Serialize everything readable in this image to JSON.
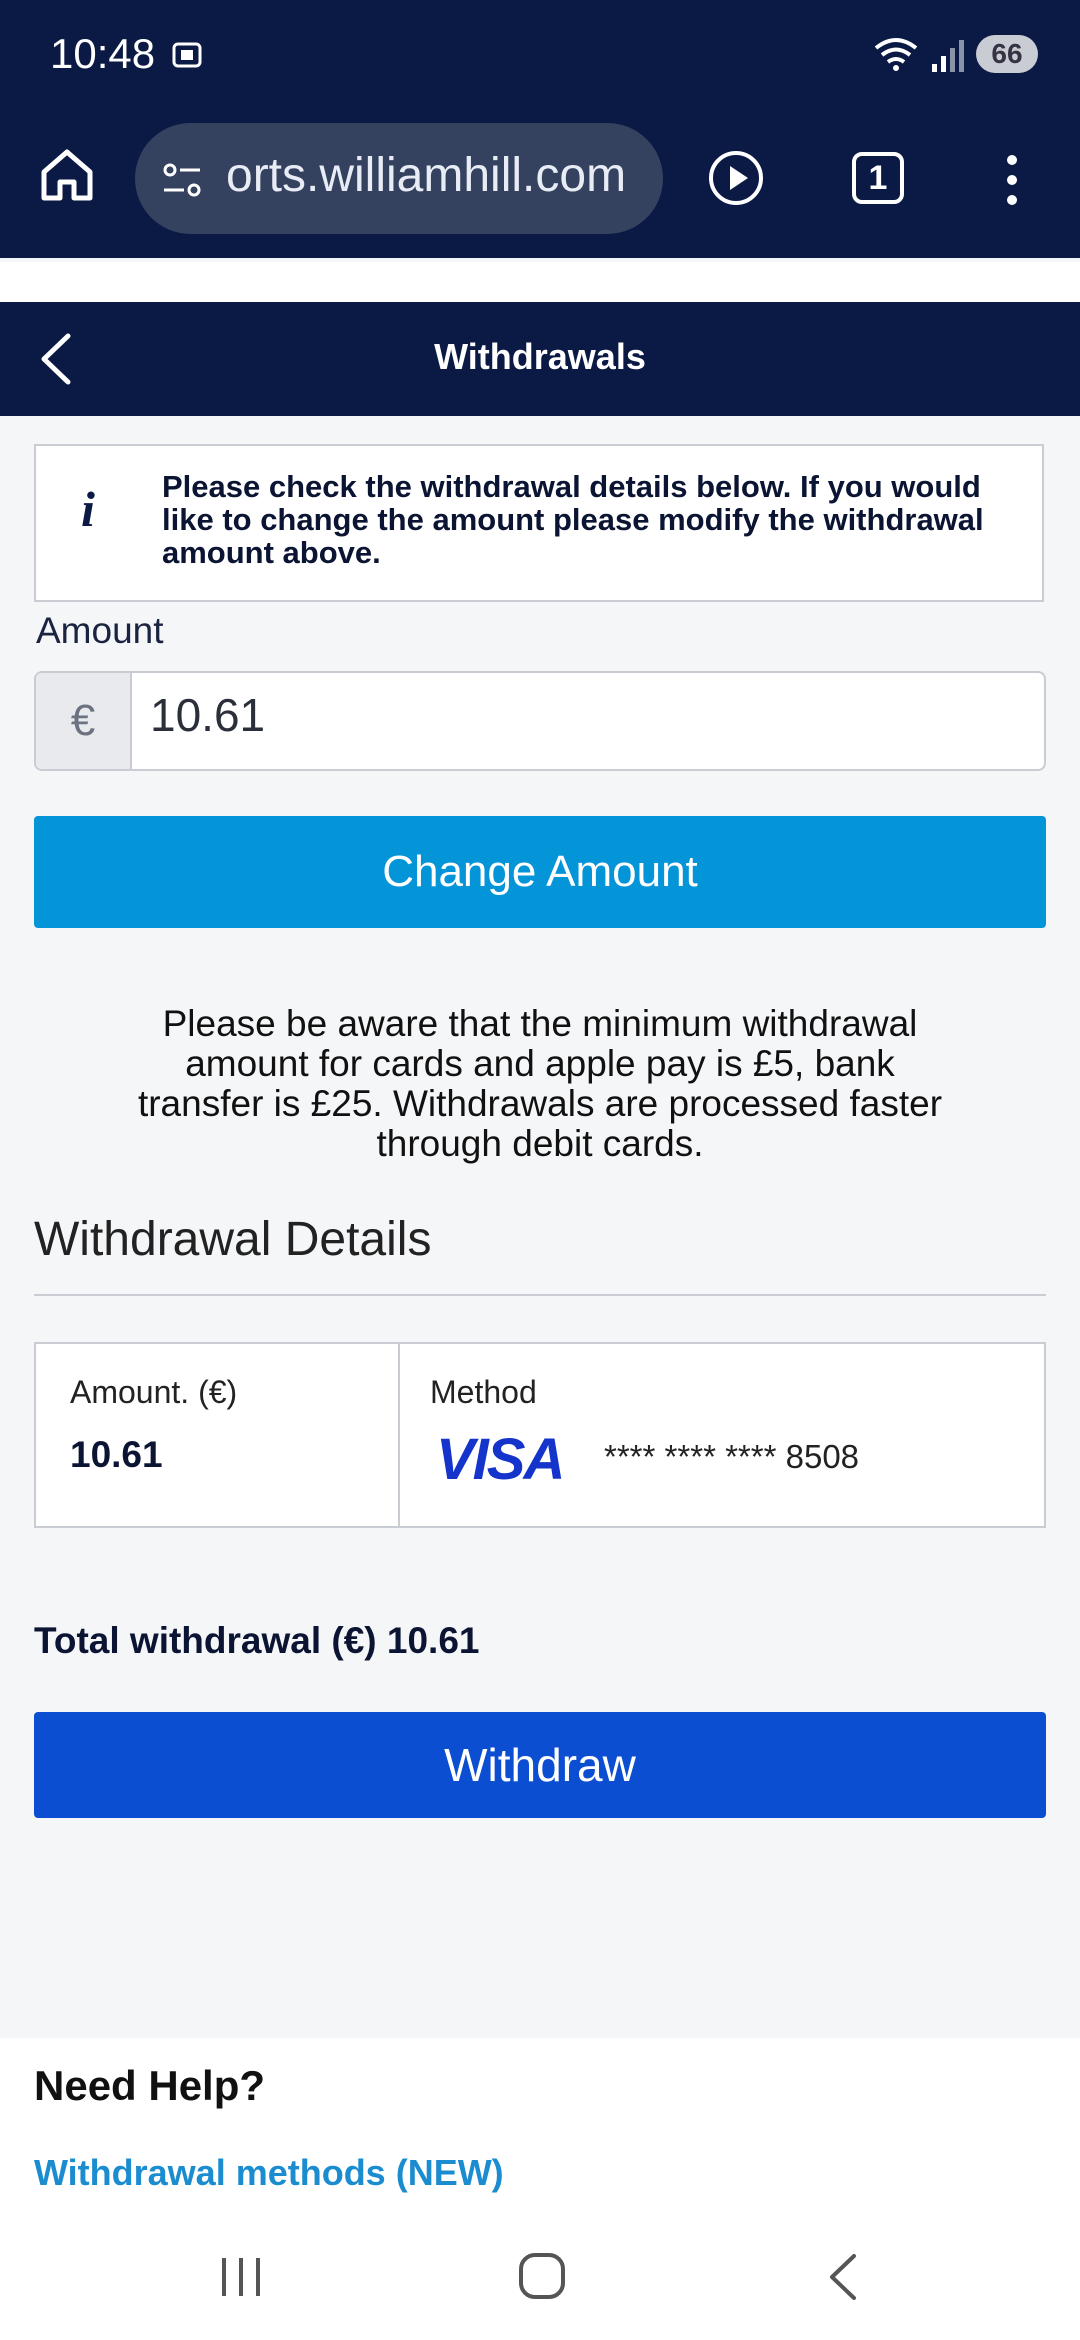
{
  "status_bar": {
    "time": "10:48",
    "battery": "66"
  },
  "browser": {
    "url": "orts.williamhill.com",
    "tab_count": "1"
  },
  "header": {
    "title": "Withdrawals"
  },
  "info": {
    "text": "Please check the withdrawal details below. If you would like to change the amount please modify the withdrawal amount above."
  },
  "amount_field": {
    "label": "Amount",
    "currency_symbol": "€",
    "value": "10.61"
  },
  "change_amount_label": "Change Amount",
  "notice": "Please be aware that the minimum withdrawal amount for cards and apple pay is £5, bank transfer is £25. Withdrawals are processed faster through debit cards.",
  "details": {
    "title": "Withdrawal Details",
    "amount_header": "Amount. (€)",
    "amount_value": "10.61",
    "method_header": "Method",
    "card_brand": "VISA",
    "card_number": "**** **** **** 8508"
  },
  "total": "Total withdrawal (€) 10.61",
  "withdraw_label": "Withdraw",
  "help": {
    "title": "Need Help?",
    "link": "Withdrawal methods (NEW)"
  },
  "colors": {
    "navy": "#0b1a45",
    "change_button": "#0494d8",
    "withdraw_button": "#0c4ed1",
    "link": "#1a8ccf",
    "visa": "#1434cb"
  }
}
